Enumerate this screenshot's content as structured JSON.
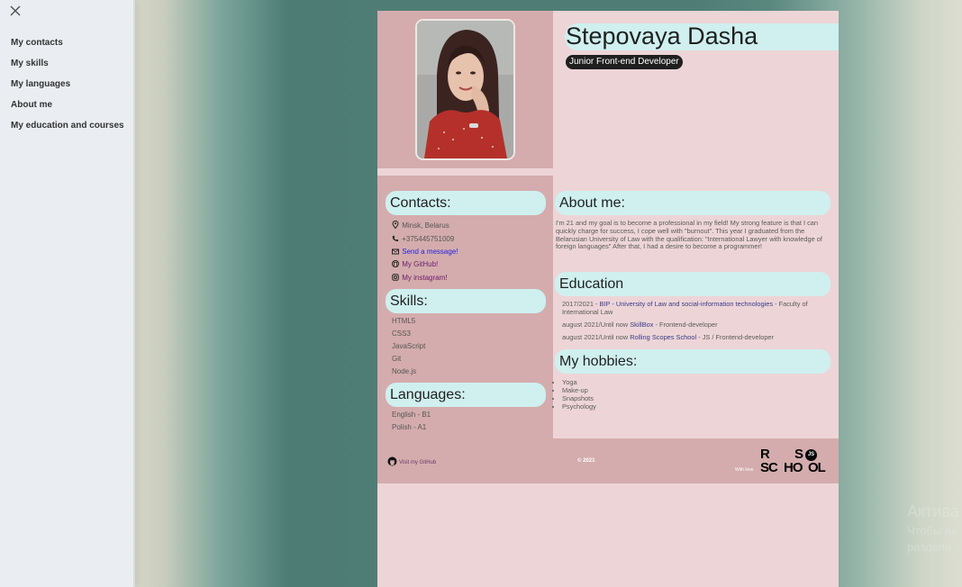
{
  "sidebar": {
    "items": [
      {
        "label": "My contacts"
      },
      {
        "label": "My skills"
      },
      {
        "label": "My languages"
      },
      {
        "label": "About me"
      },
      {
        "label": "My education and courses"
      }
    ]
  },
  "header": {
    "name": "Stepovaya Dasha",
    "role": "Junior Front-end Developer"
  },
  "contacts": {
    "title": "Contacts:",
    "location": "Minsk, Belarus",
    "phone": "+375445751009",
    "message": "Send a message!",
    "github": "My GitHub!",
    "instagram": "My instagram!"
  },
  "skills": {
    "title": "Skills:",
    "items": [
      "HTML5",
      "CSS3",
      "JavaScript",
      "Git",
      "Node.js"
    ]
  },
  "languages": {
    "title": "Languages:",
    "items": [
      "English - B1",
      "Polish - A1"
    ]
  },
  "about": {
    "title": "About me:",
    "text": "I'm 21 and my goal is to become a professional in my field! My strong feature is that I can quickly charge for success, I cope well with \"burnout\". This year I graduated from the Belarusian University of Law with the qualification: \"International Lawyer with knowledge of foreign languages\" After that, I had a desire to become a programmer!"
  },
  "education": {
    "title": "Education",
    "items": [
      {
        "prefix": "2017/2021 - ",
        "link": "BIP - University of Law and social-information technologies",
        "suffix": " - Faculty of International Law"
      },
      {
        "prefix": "august 2021/Until now ",
        "link": "SkillBox",
        "suffix": " - Frontend-developer"
      },
      {
        "prefix": "august 2021/Until now ",
        "link": "Rolling Scopes School",
        "suffix": " - JS / Frontend-developer"
      }
    ]
  },
  "hobbies": {
    "title": "My hobbies:",
    "items": [
      "Yoga",
      "Make-up",
      "Snapshots",
      "Psychology"
    ]
  },
  "footer": {
    "github_link": "Visit my GitHub",
    "copyright": "© 2021",
    "with_love": "With love",
    "logo_r": "R",
    "logo_s": "S",
    "logo_sc": "SC",
    "logo_ho": "HO",
    "logo_ol": "OL",
    "logo_js": "JS"
  },
  "watermark": {
    "line1": "Актива",
    "line2": "Чтобы ак",
    "line3": "разделе"
  },
  "colors": {
    "page_bg": "#edd5d7",
    "column_bg": "#d4acad",
    "heading_bg": "#cff0ef",
    "role_badge_bg": "#1f1f1f"
  },
  "icons": {
    "close": "close-icon",
    "location": "location-pin-icon",
    "phone": "phone-icon",
    "mail": "mail-icon",
    "github": "github-icon",
    "instagram": "instagram-icon"
  }
}
